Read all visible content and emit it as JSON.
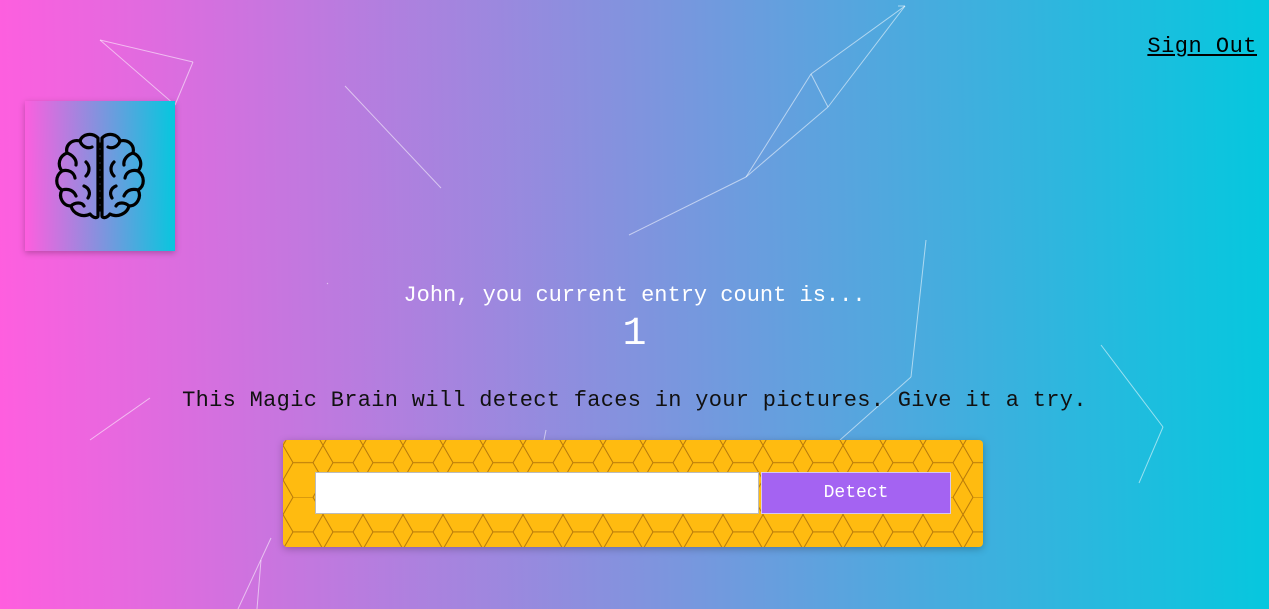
{
  "header": {
    "signout_label": "Sign Out"
  },
  "logo": {
    "icon": "brain-icon"
  },
  "rank": {
    "message": "John, you current entry count is...",
    "count": "1"
  },
  "instructions": {
    "text": "This Magic Brain will detect faces in your pictures. Give it a try."
  },
  "image_form": {
    "input_value": "",
    "input_placeholder": "",
    "button_label": "Detect"
  },
  "colors": {
    "gradient_start": "#ff5edf",
    "gradient_end": "#04c8de",
    "button": "#a463f2",
    "panel": "#ffbb10"
  }
}
